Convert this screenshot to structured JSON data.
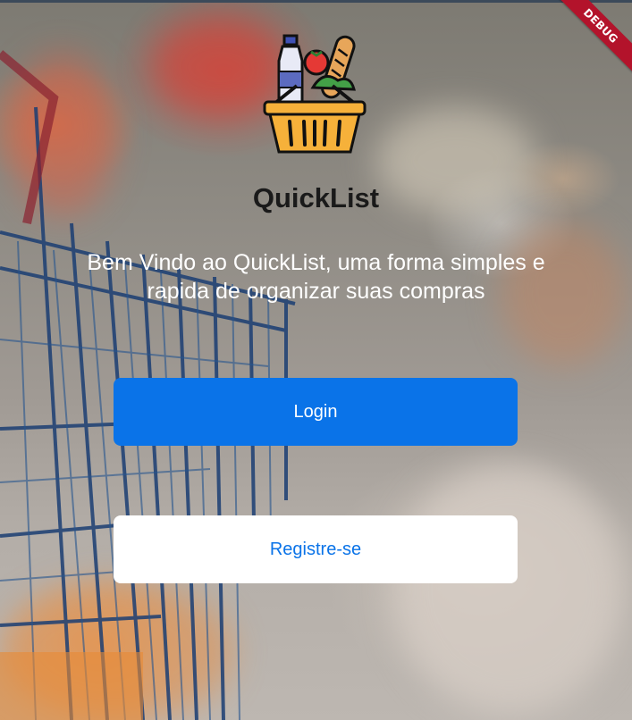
{
  "debug_banner": "DEBUG",
  "app": {
    "title": "QuickList",
    "welcome_text": "Bem Vindo ao QuickList, uma forma simples e rapida de organizar suas compras"
  },
  "actions": {
    "login_label": "Login",
    "register_label": "Registre-se"
  },
  "colors": {
    "primary": "#0a73e8",
    "button_light": "#ffffff",
    "debug_ribbon": "#b3132b"
  },
  "icons": {
    "logo": "grocery-basket-icon"
  }
}
